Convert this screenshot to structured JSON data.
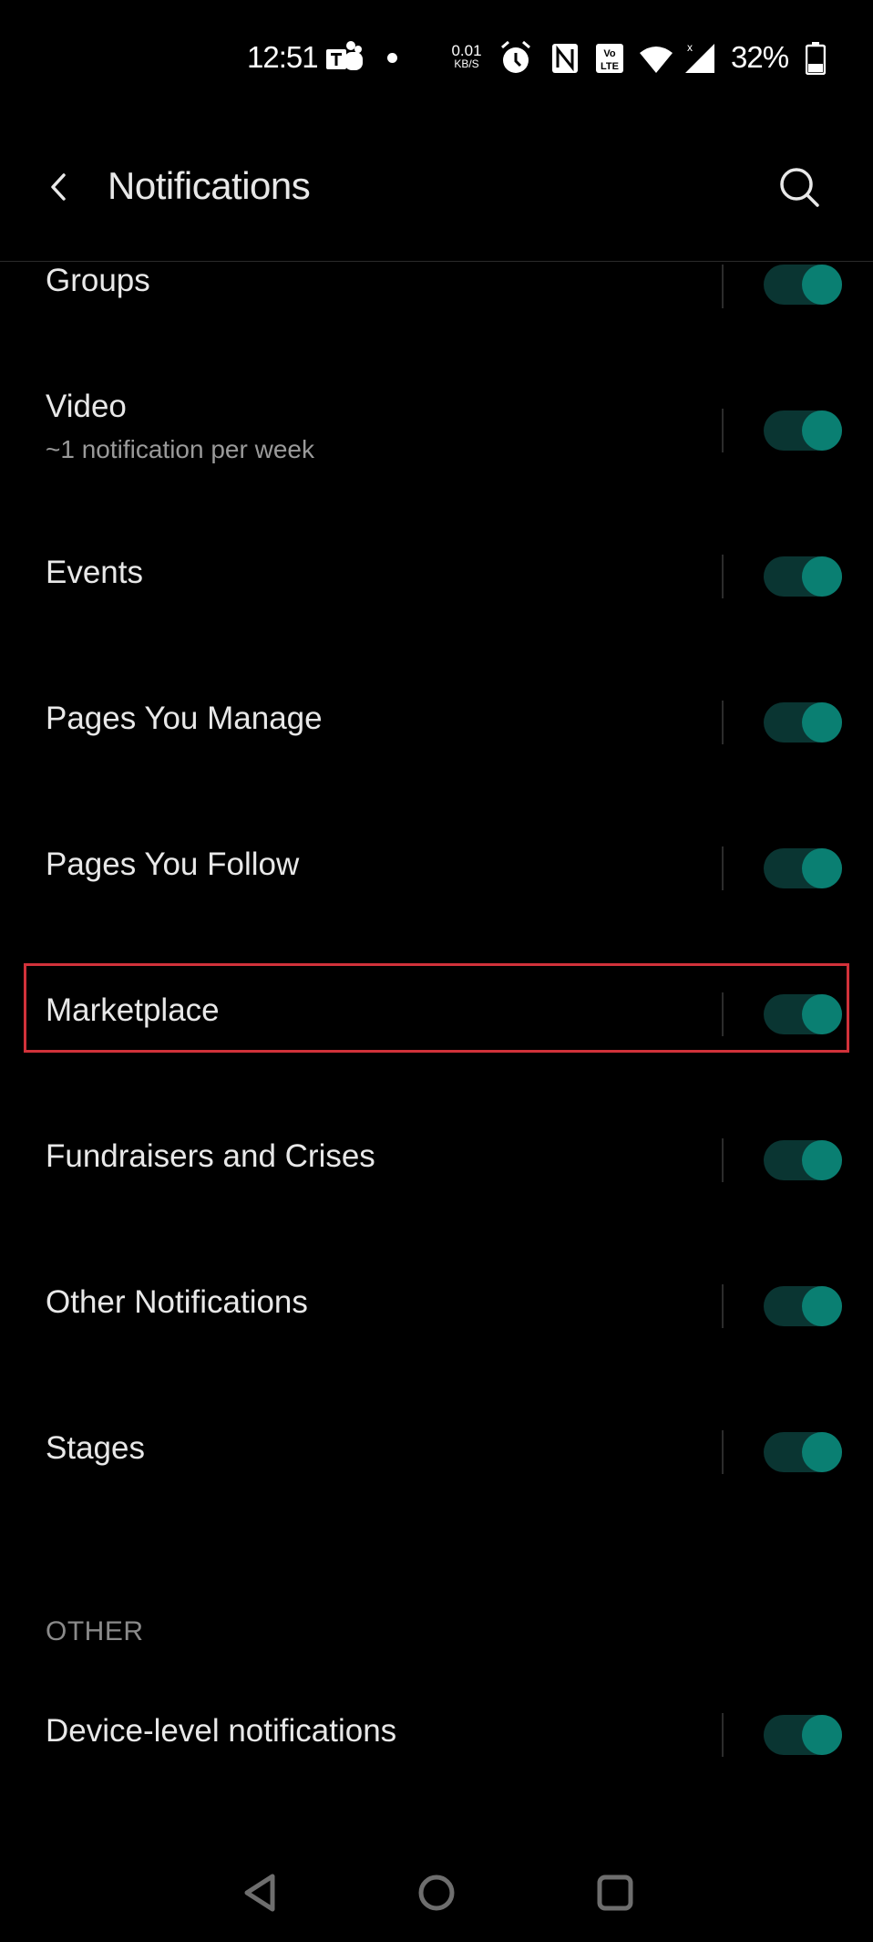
{
  "status_bar": {
    "time": "12:51",
    "net_speed_value": "0.01",
    "net_speed_unit": "KB/S",
    "battery_percent": "32%",
    "icons": [
      "teams-icon",
      "notification-dot",
      "alarm-icon",
      "nfc-icon",
      "volte-icon",
      "wifi-icon",
      "signal-icon",
      "battery-icon"
    ]
  },
  "app_bar": {
    "title": "Notifications",
    "back_icon": "chevron-left-icon",
    "search_icon": "search-icon"
  },
  "settings": [
    {
      "label": "Groups",
      "subtitle": null,
      "enabled": true
    },
    {
      "label": "Video",
      "subtitle": "~1 notification per week",
      "enabled": true
    },
    {
      "label": "Events",
      "subtitle": null,
      "enabled": true
    },
    {
      "label": "Pages You Manage",
      "subtitle": null,
      "enabled": true
    },
    {
      "label": "Pages You Follow",
      "subtitle": null,
      "enabled": true
    },
    {
      "label": "Marketplace",
      "subtitle": null,
      "enabled": true,
      "highlighted": true
    },
    {
      "label": "Fundraisers and Crises",
      "subtitle": null,
      "enabled": true
    },
    {
      "label": "Other Notifications",
      "subtitle": null,
      "enabled": true
    },
    {
      "label": "Stages",
      "subtitle": null,
      "enabled": true
    }
  ],
  "other_section": {
    "header": "OTHER",
    "items": [
      {
        "label": "Device-level notifications",
        "enabled": true
      }
    ]
  },
  "colors": {
    "toggle_track_on": "#0a3532",
    "toggle_knob_on": "#0a7f72",
    "highlight_border": "#d1323a",
    "background": "#000000"
  },
  "nav_bar": {
    "buttons": [
      "back-nav-icon",
      "home-nav-icon",
      "recents-nav-icon"
    ]
  }
}
